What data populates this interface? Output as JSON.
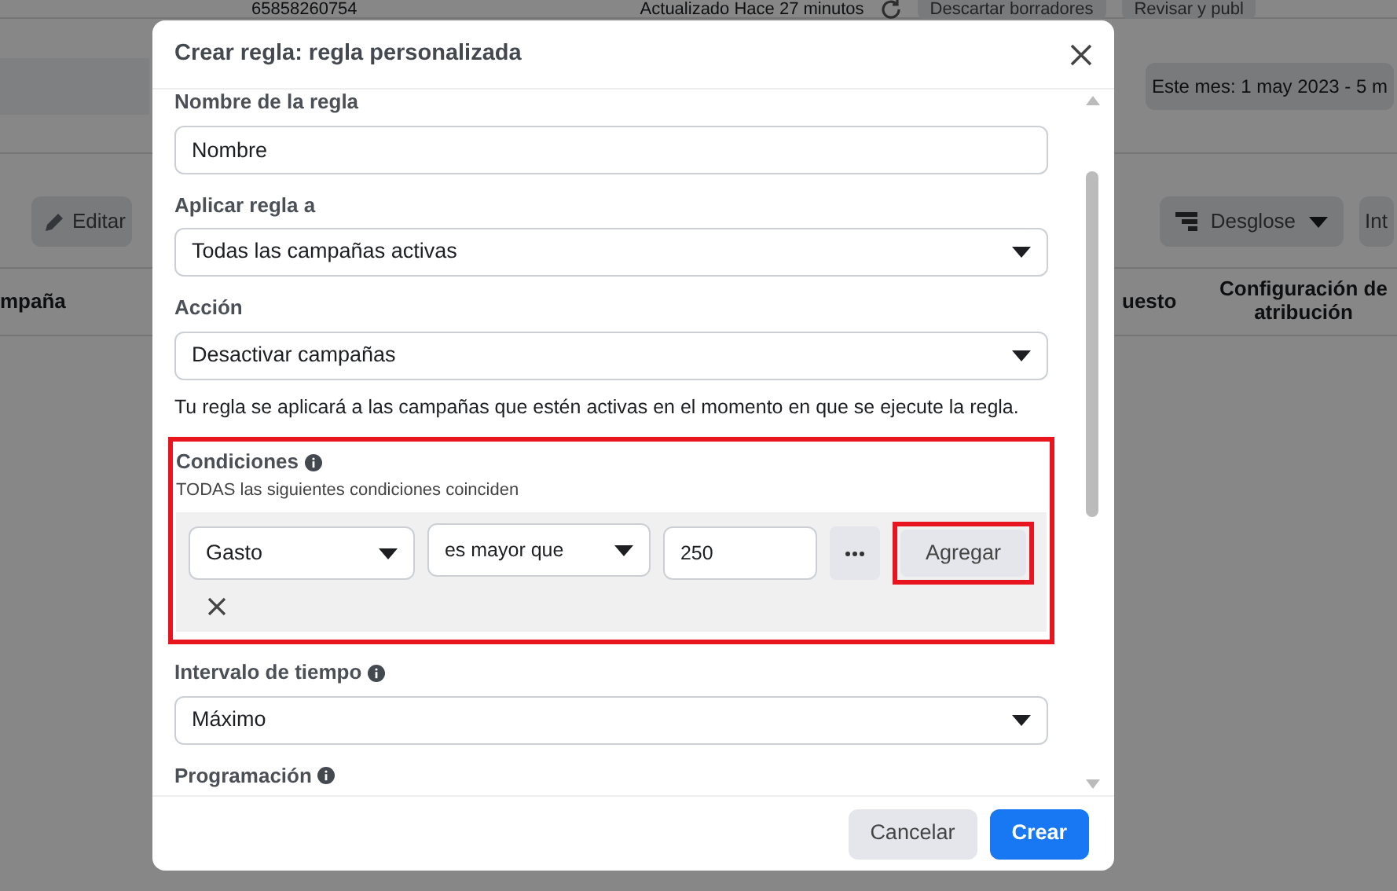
{
  "background": {
    "account_id": "65858260754",
    "updated": "Actualizado Hace 27 minutos",
    "buttons": [
      "Descartar borradores",
      "Revisar y publ"
    ],
    "date_range": "Este mes: 1 may 2023 - 5 m",
    "edit_button": "Editar",
    "breakdown_button": "Desglose",
    "cut_button": "Int",
    "columns": [
      "mpaña",
      "uesto",
      "Configuración de atribución"
    ]
  },
  "dialog": {
    "title": "Crear regla: regla personalizada",
    "sections": [
      {
        "kind": "text",
        "label": "Nombre de la regla",
        "value": "Nombre"
      },
      {
        "kind": "select",
        "label": "Aplicar regla a",
        "value": "Todas las campañas activas"
      },
      {
        "kind": "select",
        "label": "Acción",
        "value": "Desactivar campañas"
      },
      {
        "kind": "note",
        "text": "Tu regla se aplicará a las campañas que estén activas en el momento en que se ejecute la regla."
      },
      {
        "kind": "conditions",
        "label": "Condiciones",
        "info": true,
        "highlighted": true,
        "subtitle": "TODAS las siguientes condiciones coinciden",
        "metric": "Gasto",
        "operator": "es mayor que",
        "value": "250",
        "add_button": {
          "label": "Agregar",
          "highlighted": true
        }
      },
      {
        "kind": "select",
        "label": "Intervalo de tiempo",
        "info": true,
        "value": "Máximo"
      },
      {
        "kind": "heading",
        "label": "Programación",
        "info": true
      }
    ],
    "buttons": [
      {
        "label": "Cancelar",
        "kind": "secondary"
      },
      {
        "label": "Crear",
        "kind": "primary"
      }
    ]
  }
}
